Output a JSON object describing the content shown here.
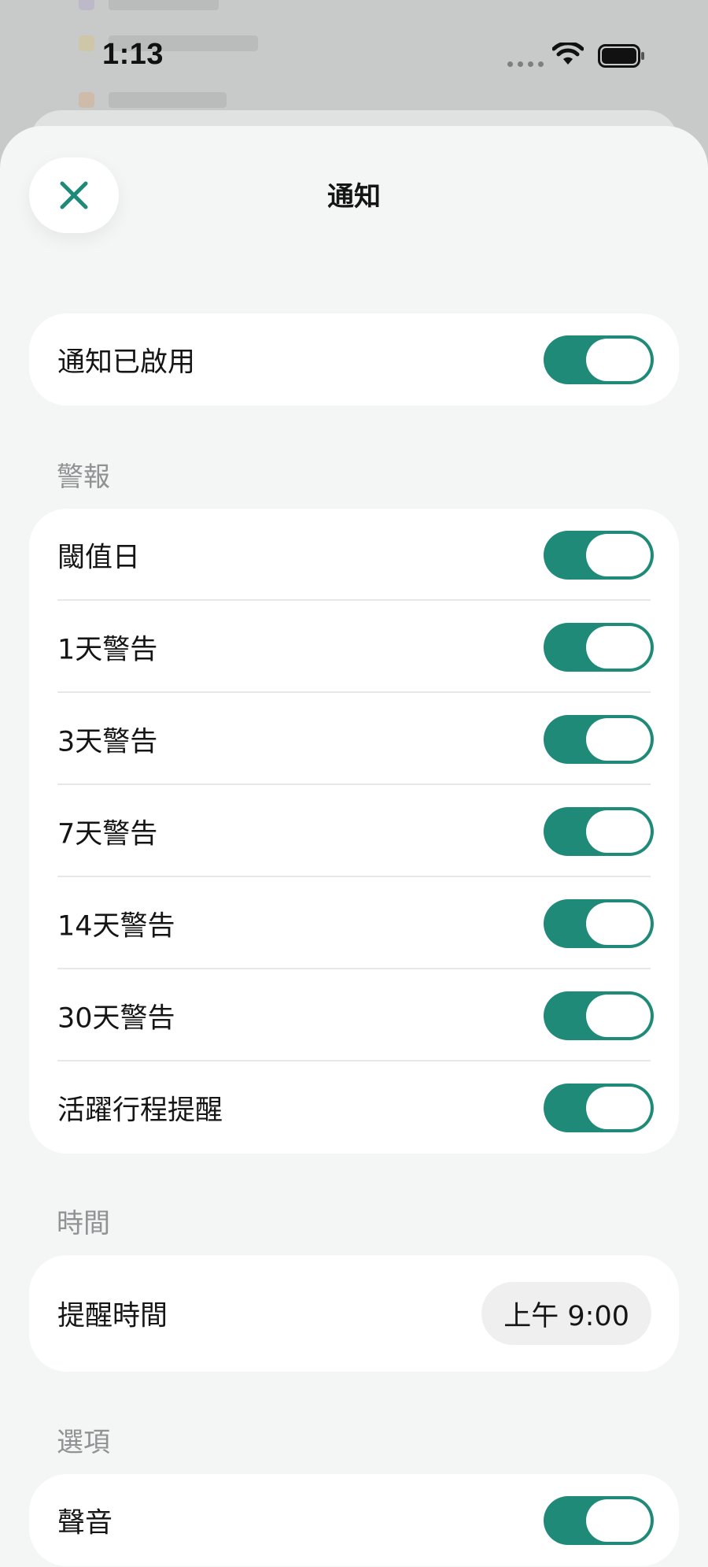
{
  "status_bar": {
    "time": "1:13"
  },
  "header": {
    "title": "通知"
  },
  "master": {
    "label": "通知已啟用",
    "enabled": true
  },
  "alerts": {
    "section_title": "警報",
    "items": [
      {
        "label": "閾值日",
        "enabled": true
      },
      {
        "label": "1天警告",
        "enabled": true
      },
      {
        "label": "3天警告",
        "enabled": true
      },
      {
        "label": "7天警告",
        "enabled": true
      },
      {
        "label": "14天警告",
        "enabled": true
      },
      {
        "label": "30天警告",
        "enabled": true
      },
      {
        "label": "活躍行程提醒",
        "enabled": true
      }
    ]
  },
  "timing": {
    "section_title": "時間",
    "reminder_label": "提醒時間",
    "reminder_value": "上午 9:00"
  },
  "options": {
    "section_title": "選項",
    "sound_label": "聲音",
    "sound_enabled": true
  },
  "colors": {
    "accent": "#1f8a78",
    "background": "#f4f5f5",
    "card": "#ffffff",
    "section_text": "#8f9393"
  }
}
